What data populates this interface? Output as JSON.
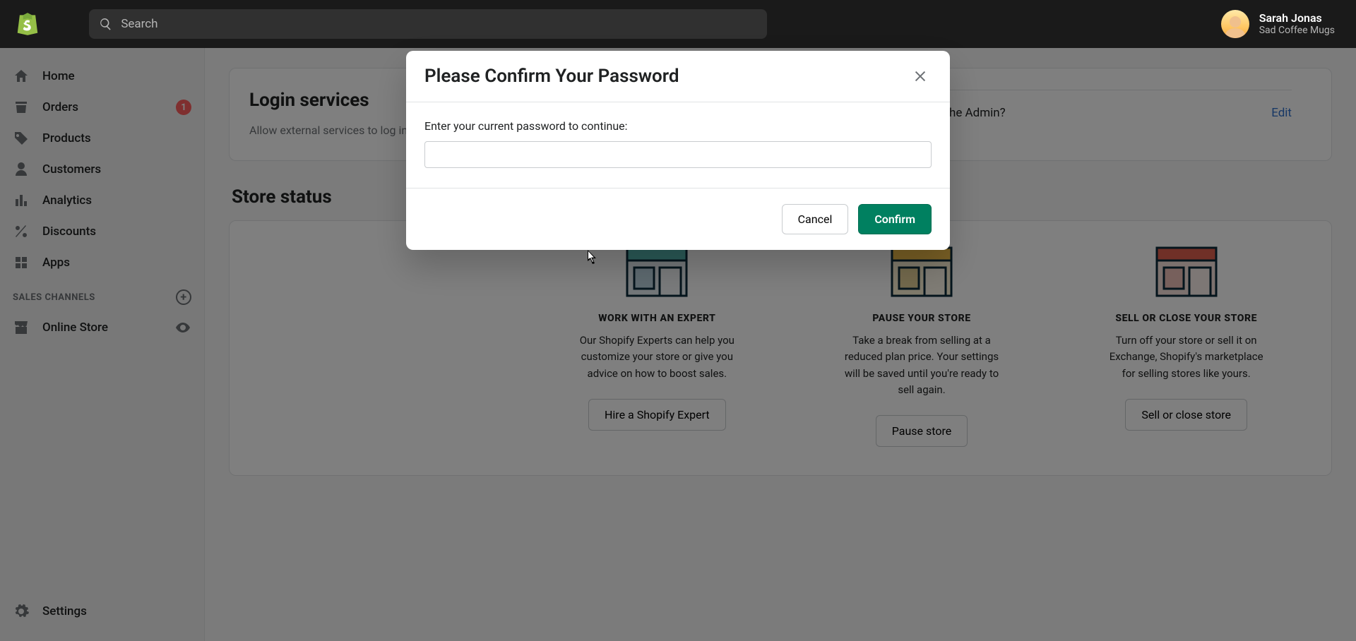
{
  "topbar": {
    "search_placeholder": "Search",
    "user_name": "Sarah Jonas",
    "store_name": "Sad Coffee Mugs"
  },
  "sidebar": {
    "items": [
      {
        "label": "Home",
        "icon": "home"
      },
      {
        "label": "Orders",
        "icon": "orders",
        "badge": "1"
      },
      {
        "label": "Products",
        "icon": "products"
      },
      {
        "label": "Customers",
        "icon": "customers"
      },
      {
        "label": "Analytics",
        "icon": "analytics"
      },
      {
        "label": "Discounts",
        "icon": "discounts"
      },
      {
        "label": "Apps",
        "icon": "apps"
      }
    ],
    "channels_header": "SALES CHANNELS",
    "channels": [
      {
        "label": "Online Store",
        "icon": "online-store"
      }
    ],
    "settings_label": "Settings"
  },
  "page": {
    "login_section_title": "Login services",
    "login_section_desc": "Allow external services to log in to Shopify.",
    "login_row_text": "Do you want to allow cordova.apps.googleusercontent.com.apps to log in to the Admin?",
    "login_row_action": "Edit",
    "store_status_title": "Store status",
    "columns": [
      {
        "heading": "WORK WITH AN EXPERT",
        "body": "Our Shopify Experts can help you customize your store or give you advice on how to boost sales.",
        "button": "Hire a Shopify Expert"
      },
      {
        "heading": "PAUSE YOUR STORE",
        "body": "Take a break from selling at a reduced plan price. Your settings will be saved until you're ready to sell again.",
        "button": "Pause store"
      },
      {
        "heading": "SELL OR CLOSE YOUR STORE",
        "body": "Turn off your store or sell it on Exchange, Shopify's marketplace for selling stores like yours.",
        "button": "Sell or close store"
      }
    ]
  },
  "modal": {
    "title": "Please Confirm Your Password",
    "label": "Enter your current password to continue:",
    "input_value": "",
    "cancel": "Cancel",
    "confirm": "Confirm"
  },
  "icons": {
    "brand_color": "#95bf47"
  }
}
